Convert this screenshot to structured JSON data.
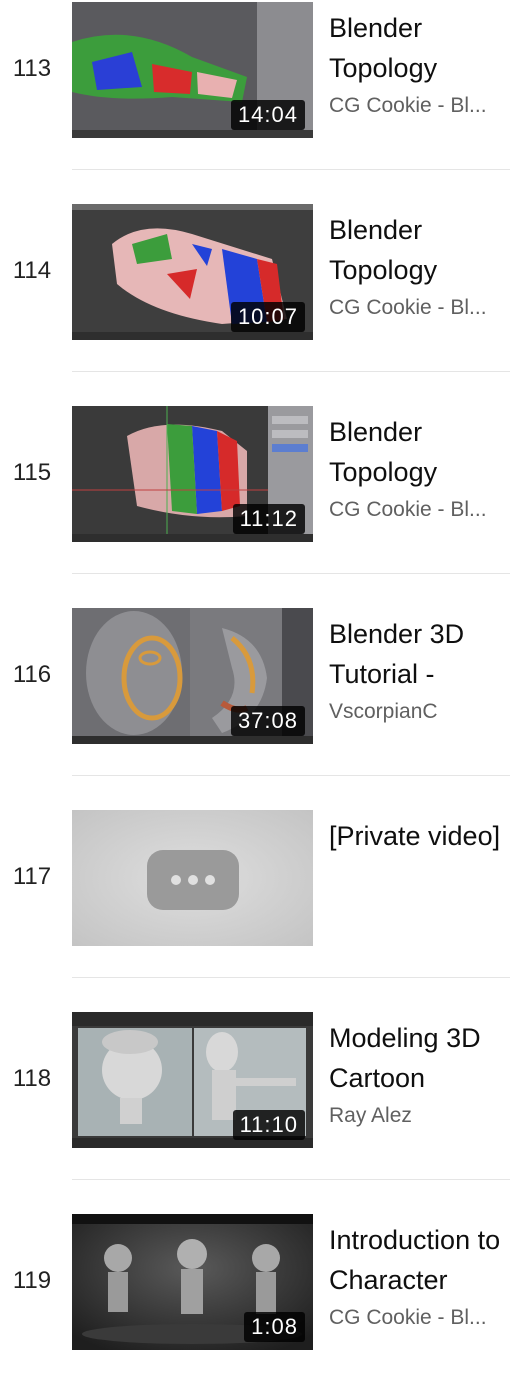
{
  "playlist": {
    "items": [
      {
        "index": "113",
        "title": "Blender Topology",
        "channel": "CG Cookie - Bl...",
        "duration": "14:04",
        "thumb": "hand-green"
      },
      {
        "index": "114",
        "title": "Blender Topology",
        "channel": "CG Cookie - Bl...",
        "duration": "10:07",
        "thumb": "hand-fingers"
      },
      {
        "index": "115",
        "title": "Blender Topology",
        "channel": "CG Cookie - Bl...",
        "duration": "11:12",
        "thumb": "hand-tube"
      },
      {
        "index": "116",
        "title": "Blender 3D Tutorial -",
        "channel": "VscorpianC",
        "duration": "37:08",
        "thumb": "face-topology"
      },
      {
        "index": "117",
        "title": "[Private video]",
        "channel": "",
        "duration": "",
        "thumb": "private"
      },
      {
        "index": "118",
        "title": "Modeling 3D Cartoon",
        "channel": "Ray Alez",
        "duration": "11:10",
        "thumb": "cartoon-head"
      },
      {
        "index": "119",
        "title": "Introduction to Character",
        "channel": "CG Cookie - Bl...",
        "duration": "1:08",
        "thumb": "characters"
      }
    ]
  }
}
